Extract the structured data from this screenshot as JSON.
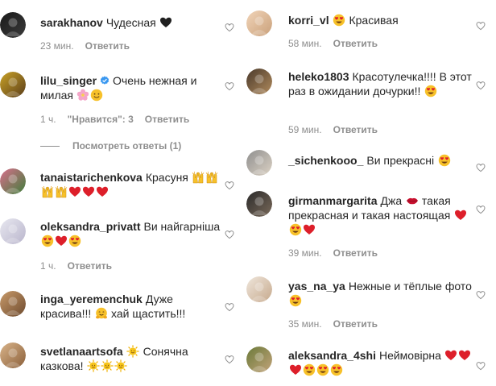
{
  "left": [
    {
      "user": "sarakhanov",
      "verified": false,
      "text": "Чудесная",
      "emojis": [
        "black-heart"
      ],
      "time": "23 мин.",
      "likes": "",
      "reply": "Ответить",
      "avatar_colors": [
        "#1a1a1a",
        "#3a3a3a"
      ]
    },
    {
      "user": "lilu_singer",
      "verified": true,
      "text": "Очень нежная и милая",
      "emojis": [
        "cherry-blossom",
        "smiling-face"
      ],
      "time": "1 ч.",
      "likes": "\"Нравится\": 3",
      "reply": "Ответить",
      "avatar_colors": [
        "#c9a227",
        "#5a3d1a"
      ]
    },
    {
      "user": "tanaistarichenkova",
      "verified": false,
      "text": "Красуня",
      "emojis": [
        "raising-hands",
        "raising-hands",
        "raising-hands",
        "raising-hands",
        "red-heart",
        "red-heart",
        "red-heart"
      ],
      "time": "",
      "likes": "",
      "reply": "",
      "avatar_colors": [
        "#d96f8c",
        "#3f7d3a"
      ]
    },
    {
      "user": "oleksandra_privatt",
      "verified": false,
      "text": "Ви найгарніша",
      "emojis": [
        "heart-eyes",
        "red-heart",
        "heart-eyes"
      ],
      "time": "1 ч.",
      "likes": "",
      "reply": "Ответить",
      "avatar_colors": [
        "#e8e8f0",
        "#b9b5cc"
      ]
    },
    {
      "user": "inga_yeremenchuk",
      "verified": false,
      "text": "Дуже красива!!!",
      "emojis": [
        "hugging-face"
      ],
      "text_after": "хай щастить!!!",
      "time": "",
      "likes": "",
      "reply": "",
      "avatar_colors": [
        "#c89a6a",
        "#6e4b2f"
      ]
    },
    {
      "user": "svetlanaartsofa",
      "verified": false,
      "text": "",
      "emojis": [
        "sun-with-face"
      ],
      "text_after": "Сонячна казкова!",
      "emojis_after": [
        "sun-with-face",
        "sun-with-face",
        "sun-with-face"
      ],
      "time": "",
      "likes": "",
      "reply": "",
      "avatar_colors": [
        "#d9b48a",
        "#8a5f3a"
      ]
    }
  ],
  "view_replies": "Посмотреть ответы (1)",
  "right": [
    {
      "user": "korri_vl",
      "verified": false,
      "text": "",
      "emojis": [
        "heart-eyes"
      ],
      "text_after": "Красивая",
      "time": "58 мин.",
      "likes": "",
      "reply": "Ответить",
      "avatar_colors": [
        "#f1d4b8",
        "#c9a07a"
      ]
    },
    {
      "user": "heleko1803",
      "verified": false,
      "text": "Красотулечка!!!! В этот раз в ожидании дочурки!!",
      "emojis": [
        "heart-eyes"
      ],
      "time": "59 мин.",
      "likes": "",
      "reply": "Ответить",
      "avatar_colors": [
        "#4a3a2c",
        "#b08a5c"
      ]
    },
    {
      "user": "_sichenkooo_",
      "verified": false,
      "text": "Ви прекрасні",
      "emojis": [
        "heart-eyes"
      ],
      "time": "",
      "likes": "",
      "reply": "",
      "avatar_colors": [
        "#8f8f8f",
        "#dcd2c4"
      ]
    },
    {
      "user": "girmanmargarita",
      "verified": false,
      "text": "Джа",
      "emojis": [
        "lips"
      ],
      "text_after": "такая прекрасная и такая настоящая",
      "emojis_after": [
        "red-heart",
        "heart-eyes",
        "red-heart"
      ],
      "time": "39 мин.",
      "likes": "",
      "reply": "Ответить",
      "avatar_colors": [
        "#2a2a2a",
        "#7a6a5a"
      ]
    },
    {
      "user": "yas_na_ya",
      "verified": false,
      "text": "Нежные и тёплые фото",
      "emojis": [
        "heart-eyes"
      ],
      "time": "35 мин.",
      "likes": "",
      "reply": "Ответить",
      "avatar_colors": [
        "#efe6dc",
        "#c6a98c"
      ]
    },
    {
      "user": "aleksandra_4shi",
      "verified": false,
      "text": "Неймовірна",
      "emojis": [
        "red-heart",
        "red-heart",
        "red-heart",
        "heart-eyes",
        "heart-eyes",
        "heart-eyes"
      ],
      "time": "",
      "likes": "",
      "reply": "",
      "avatar_colors": [
        "#6b7a3a",
        "#c2a37a"
      ]
    }
  ]
}
